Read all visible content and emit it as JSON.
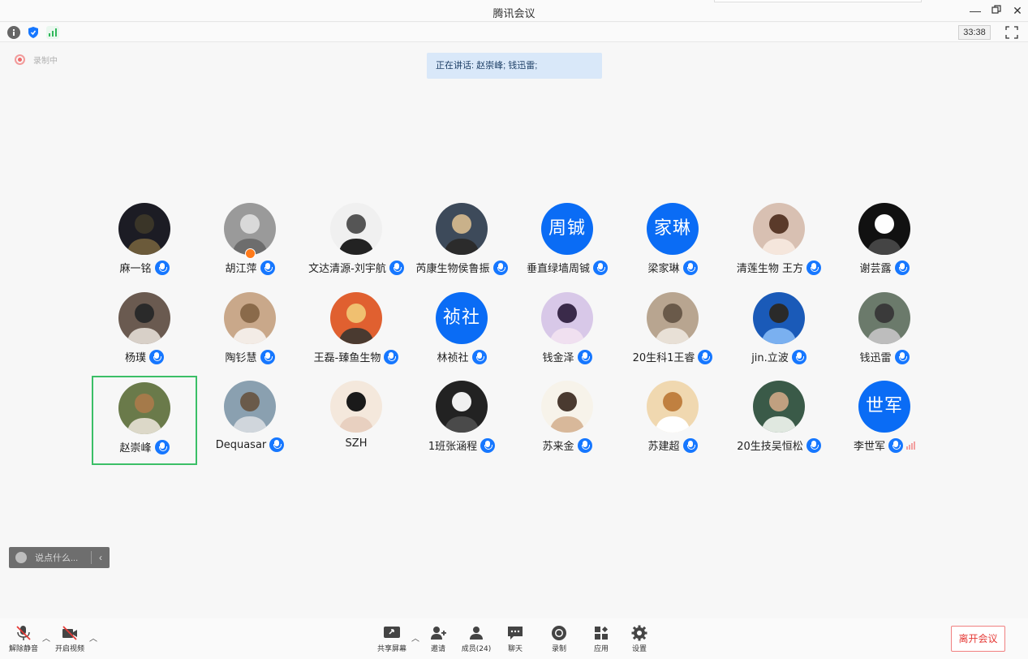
{
  "window": {
    "title": "腾讯会议",
    "controls": [
      "minimize",
      "restore",
      "close"
    ]
  },
  "status": {
    "timer": "33:38",
    "recording_label": "录制中"
  },
  "speaking": {
    "text": "正在讲话: 赵崇峰; 钱迅雷;"
  },
  "participants": [
    {
      "name": "麻一铭",
      "avatar": "photo",
      "mic": "on"
    },
    {
      "name": "胡江萍",
      "avatar": "photo",
      "mic": "on",
      "host": true
    },
    {
      "name": "文达清源-刘宇航",
      "avatar": "photo",
      "mic": "on"
    },
    {
      "name": "芮康生物侯鲁振",
      "avatar": "photo",
      "mic": "on"
    },
    {
      "name": "垂直绿墙周铖",
      "avatar": "text",
      "avatar_text": "周铖",
      "mic": "on"
    },
    {
      "name": "梁家琳",
      "avatar": "text",
      "avatar_text": "家琳",
      "mic": "on"
    },
    {
      "name": "清莲生物 王方",
      "avatar": "photo",
      "mic": "on"
    },
    {
      "name": "谢芸露",
      "avatar": "photo",
      "mic": "on"
    },
    {
      "name": "杨璞",
      "avatar": "photo",
      "mic": "on"
    },
    {
      "name": "陶钐慧",
      "avatar": "photo",
      "mic": "on"
    },
    {
      "name": "王磊-臻鱼生物",
      "avatar": "photo",
      "mic": "on"
    },
    {
      "name": "林祯社",
      "avatar": "text",
      "avatar_text": "祯社",
      "mic": "on"
    },
    {
      "name": "钱金泽",
      "avatar": "photo",
      "mic": "on"
    },
    {
      "name": "20生科1王睿",
      "avatar": "photo",
      "mic": "on"
    },
    {
      "name": "jin.立波",
      "avatar": "photo",
      "mic": "on"
    },
    {
      "name": "钱迅雷",
      "avatar": "photo",
      "mic": "on"
    },
    {
      "name": "赵崇峰",
      "avatar": "photo",
      "mic": "on",
      "active": true
    },
    {
      "name": "Dequasar",
      "avatar": "photo",
      "mic": "on"
    },
    {
      "name": "SZH",
      "avatar": "photo",
      "mic": "none"
    },
    {
      "name": "1班张涵程",
      "avatar": "photo",
      "mic": "on"
    },
    {
      "name": "苏来金",
      "avatar": "photo",
      "mic": "on"
    },
    {
      "name": "苏建超",
      "avatar": "photo",
      "mic": "on"
    },
    {
      "name": "20生技吴恒松",
      "avatar": "photo",
      "mic": "on"
    },
    {
      "name": "李世军",
      "avatar": "text",
      "avatar_text": "世军",
      "mic": "on",
      "speaking_level": true
    }
  ],
  "chat": {
    "placeholder": "说点什么..."
  },
  "toolbar": {
    "unmute": "解除静音",
    "start_video": "开启视频",
    "share": "共享屏幕",
    "invite": "邀请",
    "members": "成员(24)",
    "chat": "聊天",
    "record": "录制",
    "apps": "应用",
    "settings": "设置",
    "leave": "离开会议"
  },
  "colors": {
    "accent": "#1677ff",
    "active_border": "#3bbf67",
    "leave": "#e53935"
  }
}
